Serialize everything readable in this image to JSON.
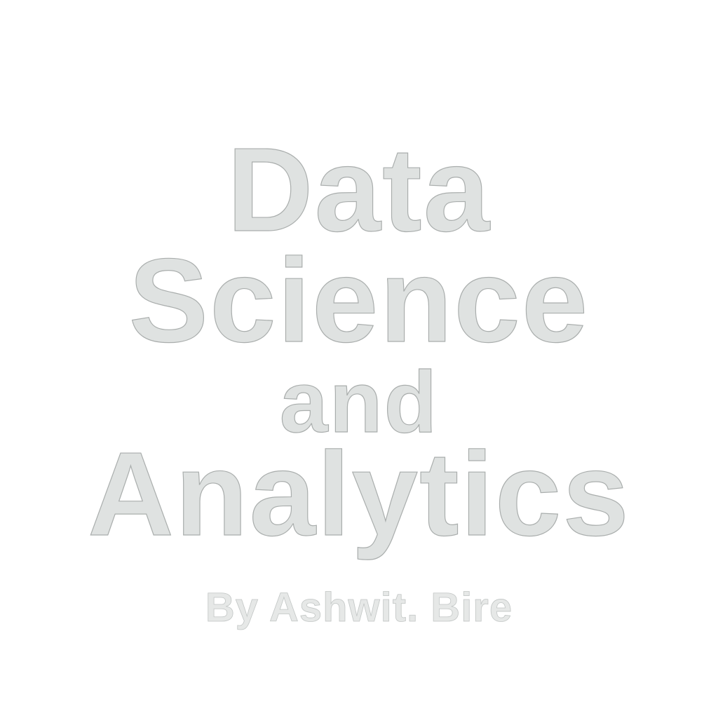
{
  "title": {
    "line1": "Data",
    "line2": "Science",
    "line3": "and",
    "line4": "Analytics"
  },
  "byline": "By Ashwit. Bire",
  "colors": {
    "background": "#ffffff",
    "title_fill": "#dfe2e1",
    "title_outline": "#a9adac",
    "byline_fill": "#e6e8e7"
  }
}
